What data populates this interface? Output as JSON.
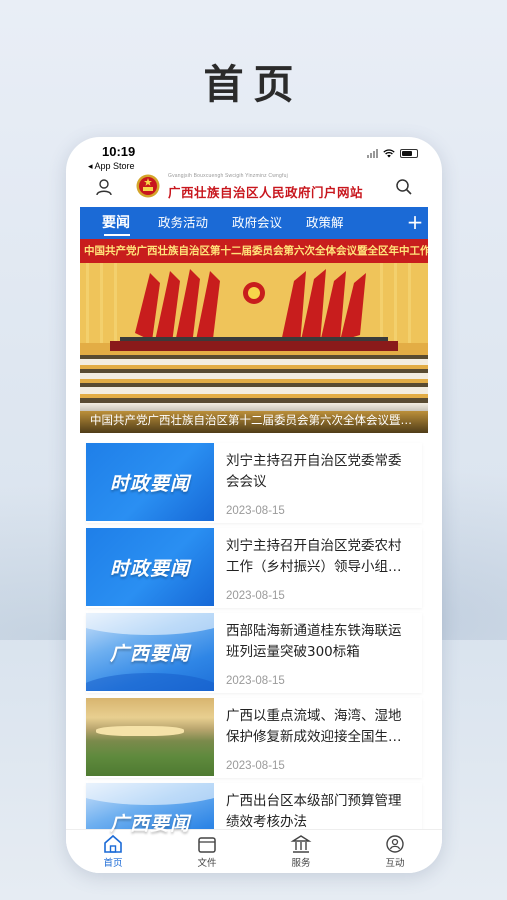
{
  "headline": "首页",
  "status": {
    "time": "10:19",
    "back_app": "◂ App Store"
  },
  "header": {
    "site_subtitle": "Gvangjsih Bouxcuengh Swcigih Yinzminz Cwngfuj",
    "site_title": "广西壮族自治区人民政府门户网站"
  },
  "tabs": [
    {
      "label": "要闻",
      "active": true
    },
    {
      "label": "政务活动",
      "active": false
    },
    {
      "label": "政府会议",
      "active": false
    },
    {
      "label": "政策解",
      "active": false
    }
  ],
  "banner": {
    "red_banner_text": "中国共产党广西壮族自治区第十二届委员会第六次全体会议暨全区年中工作会议",
    "caption": "中国共产党广西壮族自治区第十二届委员会第六次全体会议暨全区年中工作会议"
  },
  "news": [
    {
      "thumb_text": "时政要闻",
      "thumb_style": "blue",
      "title": "刘宁主持召开自治区党委常委会会议",
      "date": "2023-08-15"
    },
    {
      "thumb_text": "时政要闻",
      "thumb_style": "blue",
      "title": "刘宁主持召开自治区党委农村工作（乡村振兴）领导小组会议",
      "date": "2023-08-15"
    },
    {
      "thumb_text": "广西要闻",
      "thumb_style": "wave",
      "title": "西部陆海新通道桂东铁海联运班列运量突破300标箱",
      "date": "2023-08-15"
    },
    {
      "thumb_text": "",
      "thumb_style": "photo",
      "title": "广西以重点流域、海湾、湿地保护修复新成效迎接全国生态日",
      "date": "2023-08-15"
    },
    {
      "thumb_text": "广西要闻",
      "thumb_style": "wave",
      "title": "广西出台区本级部门预算管理绩效考核办法",
      "date": ""
    }
  ],
  "bottom_nav": [
    {
      "label": "首页",
      "icon": "home-icon",
      "active": true
    },
    {
      "label": "文件",
      "icon": "folder-icon",
      "active": false
    },
    {
      "label": "服务",
      "icon": "service-building-icon",
      "active": false
    },
    {
      "label": "互动",
      "icon": "chat-person-icon",
      "active": false
    }
  ],
  "colors": {
    "brand_blue": "#1b6ad6",
    "brand_red": "#c8161d"
  }
}
